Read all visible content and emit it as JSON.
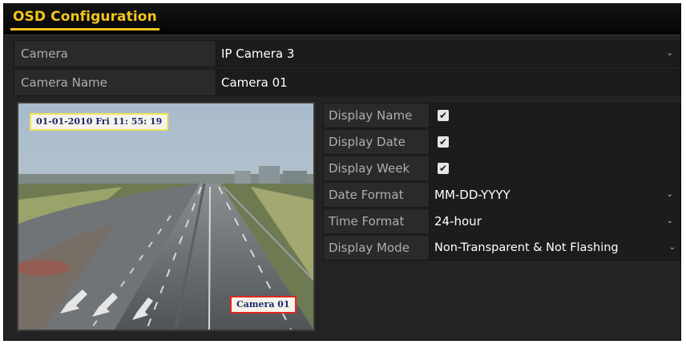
{
  "window": {
    "title": "OSD Configuration"
  },
  "camera": {
    "label": "Camera",
    "value": "IP Camera 3"
  },
  "camera_name": {
    "label": "Camera Name",
    "value": "Camera 01"
  },
  "preview": {
    "osd_datetime": "01-01-2010  Fri  11: 55: 19",
    "osd_camera_name": "Camera 01"
  },
  "settings": {
    "display_name": {
      "label": "Display Name",
      "checked": true
    },
    "display_date": {
      "label": "Display Date",
      "checked": true
    },
    "display_week": {
      "label": "Display Week",
      "checked": true
    },
    "date_format": {
      "label": "Date Format",
      "value": "MM-DD-YYYY"
    },
    "time_format": {
      "label": "Time Format",
      "value": "24-hour"
    },
    "display_mode": {
      "label": "Display Mode",
      "value": "Non-Transparent & Not Flashing"
    }
  },
  "icons": {
    "checkmark": "✔",
    "dropdown": "⌄"
  },
  "colors": {
    "title_accent": "#f0c51c",
    "osd_date_border": "#ece45a",
    "osd_name_border": "#e0281f"
  }
}
